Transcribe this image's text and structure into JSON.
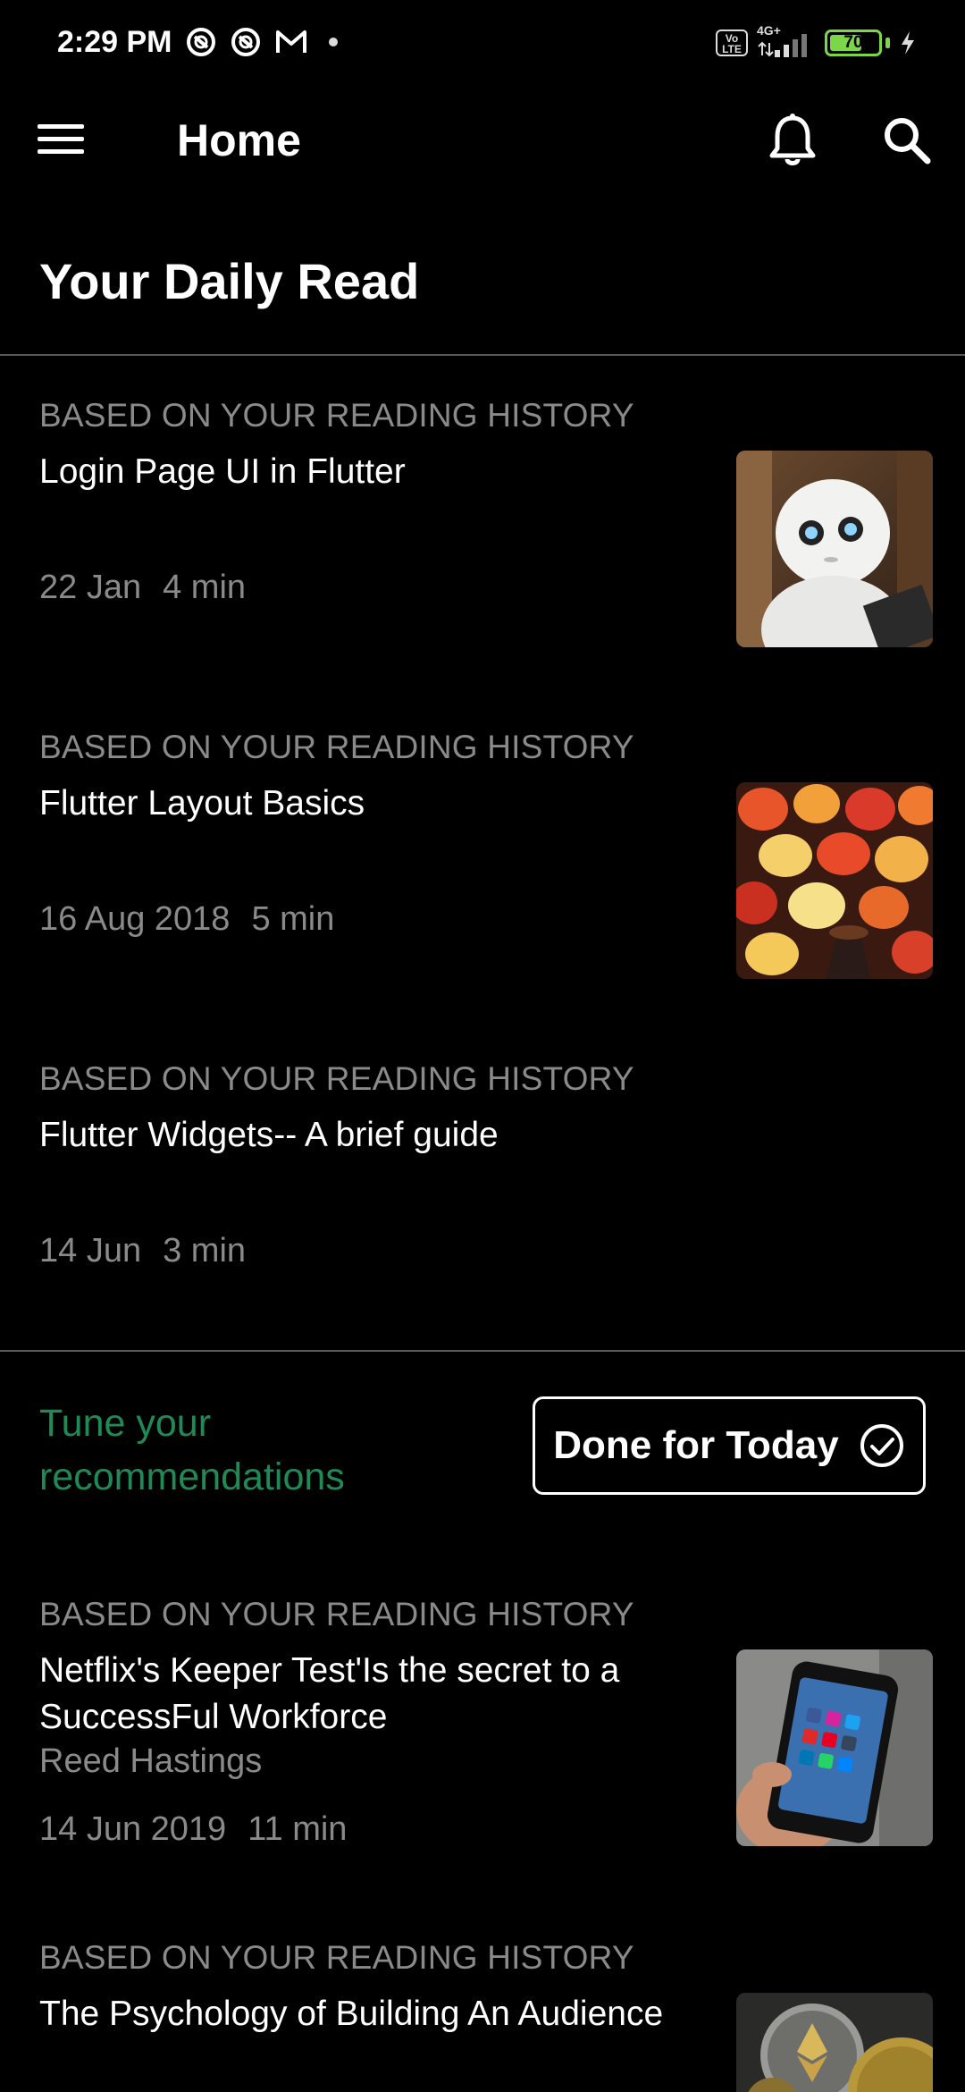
{
  "status_bar": {
    "time": "2:29 PM",
    "network": "4G+",
    "volte": "Vo LTE",
    "battery": "70",
    "battery_level": 0.7
  },
  "app_bar": {
    "title": "Home"
  },
  "section_title": "Your Daily Read",
  "articles_top": [
    {
      "label": "BASED ON YOUR READING HISTORY",
      "title": "Login Page UI in Flutter",
      "date": "22 Jan",
      "duration": "4 min",
      "thumb": "robot"
    },
    {
      "label": "BASED ON YOUR READING HISTORY",
      "title": "Flutter Layout Basics",
      "date": "16 Aug 2018",
      "duration": "5 min",
      "thumb": "lanterns"
    },
    {
      "label": "BASED ON YOUR READING HISTORY",
      "title": "Flutter Widgets-- A brief guide",
      "date": "14 Jun",
      "duration": "3 min",
      "thumb": ""
    }
  ],
  "tune": {
    "line1": "Tune your",
    "line2": "recommendations",
    "done_label": "Done for Today"
  },
  "articles_bottom": [
    {
      "label": "BASED ON YOUR READING HISTORY",
      "title": "Netflix's Keeper Test'Is the secret to a SuccessFul Workforce",
      "author": "Reed Hastings",
      "date": "14 Jun 2019",
      "duration": "11 min",
      "thumb": "phone"
    },
    {
      "label": "BASED ON YOUR READING HISTORY",
      "title": "The Psychology of Building An Audience",
      "thumb": "coins"
    }
  ]
}
